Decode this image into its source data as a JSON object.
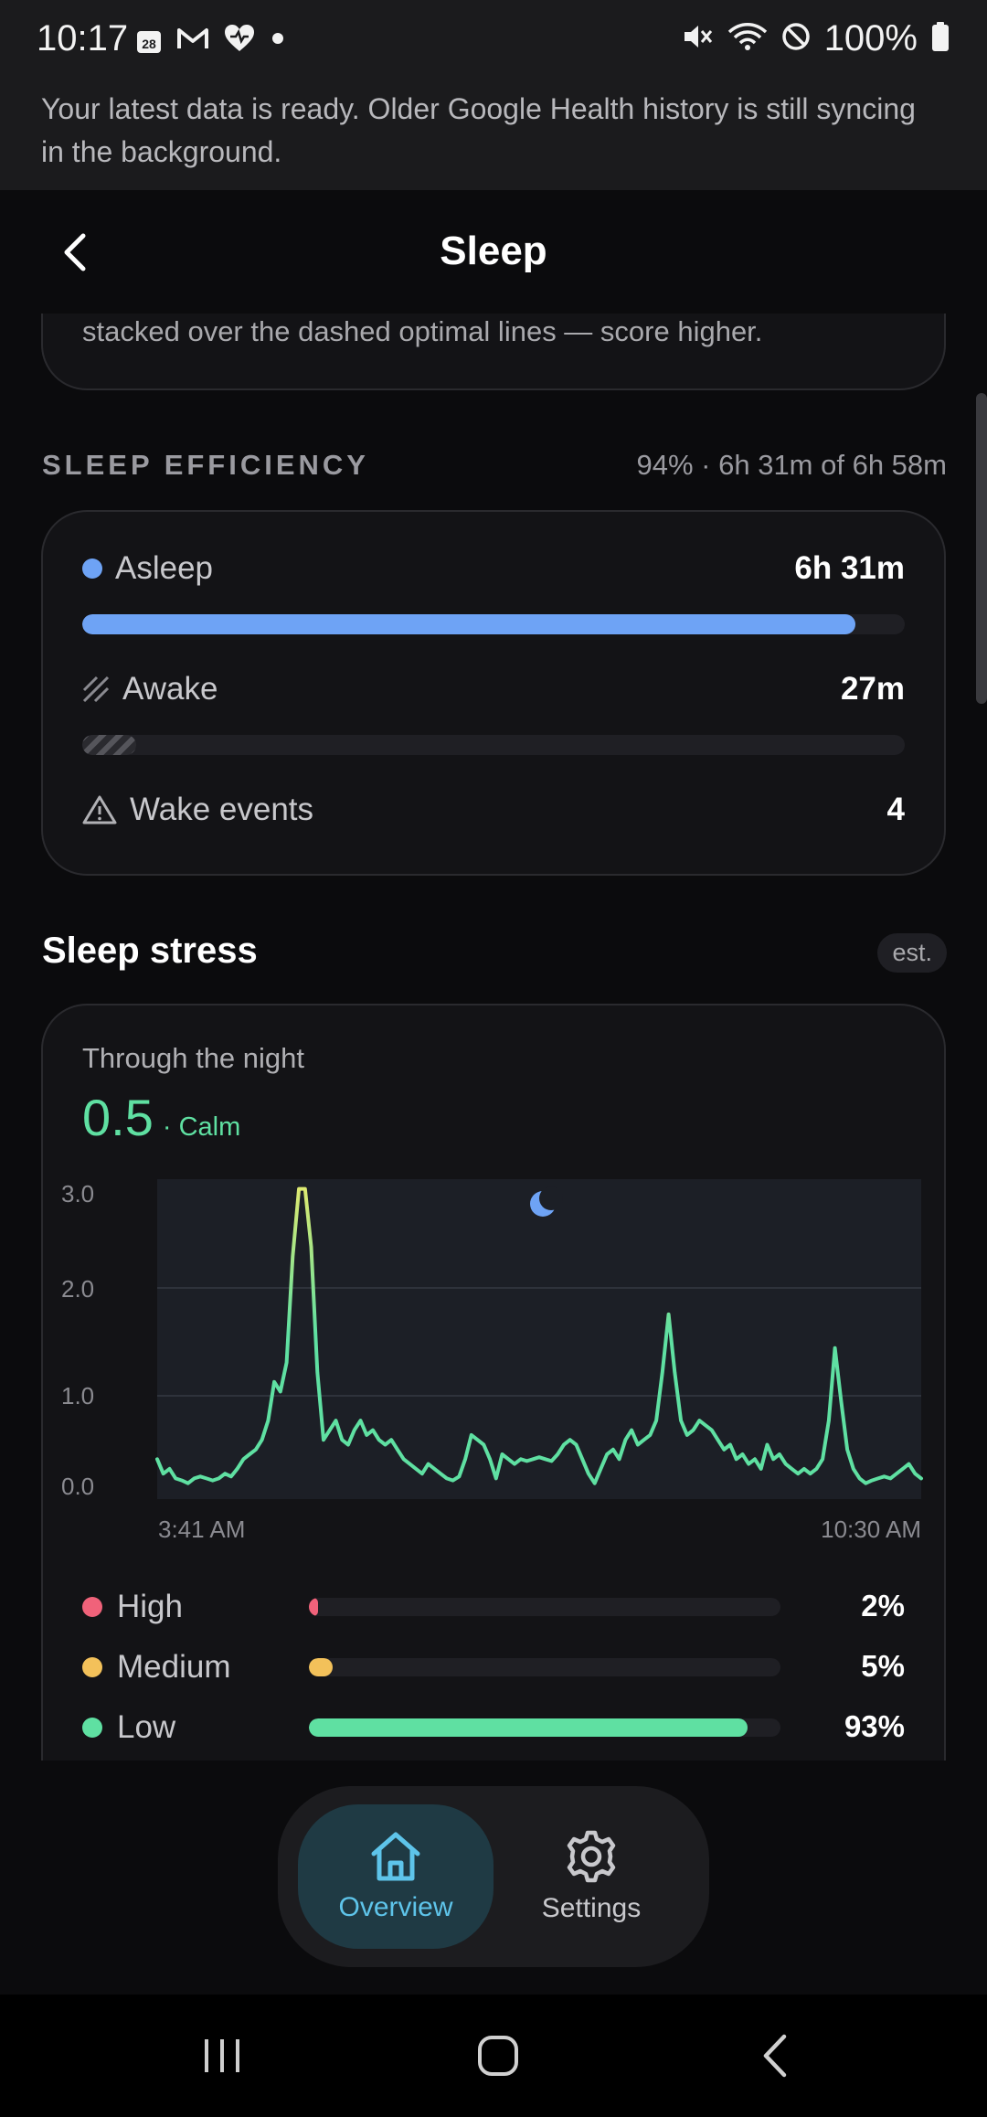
{
  "status_bar": {
    "time": "10:17",
    "calendar_day": "28",
    "battery": "100%",
    "icons_left": [
      "calendar-icon",
      "gmail-icon",
      "health-heart-icon",
      "notification-dot-icon"
    ],
    "icons_right": [
      "mute-icon",
      "wifi-icon",
      "dnd-icon",
      "battery-icon"
    ]
  },
  "banner": {
    "text": "Your latest data is ready. Older Google Health history is still syncing in the background."
  },
  "app_bar": {
    "title": "Sleep",
    "back_icon": "chevron-left-icon"
  },
  "previous_card": {
    "text": "stacked over the dashed optimal lines — score higher."
  },
  "efficiency": {
    "title": "SLEEP EFFICIENCY",
    "summary": "94% · 6h 31m of 6h 58m",
    "asleep": {
      "label": "Asleep",
      "value": "6h 31m",
      "fraction": 0.94,
      "color": "#6ea3f5"
    },
    "awake": {
      "label": "Awake",
      "value": "27m",
      "fraction": 0.065,
      "icon": "hatch-icon"
    },
    "wake_events": {
      "label": "Wake events",
      "value": "4",
      "icon": "warning-triangle-icon"
    }
  },
  "stress": {
    "title": "Sleep stress",
    "badge": "est.",
    "subtitle": "Through the night",
    "score": "0.5",
    "score_label": "· Calm",
    "accent": "#5fe0a2",
    "levels": [
      {
        "label": "High",
        "value": "2%",
        "fraction": 0.02,
        "color": "#f0627a"
      },
      {
        "label": "Medium",
        "value": "5%",
        "fraction": 0.05,
        "color": "#f3c15a"
      },
      {
        "label": "Low",
        "value": "93%",
        "fraction": 0.93,
        "color": "#5fe0a2"
      }
    ]
  },
  "chart_data": {
    "type": "line",
    "title": "",
    "xlabel": "",
    "ylabel": "",
    "ylim": [
      0,
      3.2
    ],
    "y_ticks": [
      "3.0",
      "2.0",
      "1.0",
      "0.0"
    ],
    "x_tick_labels": [
      "3:41 AM",
      "10:30 AM"
    ],
    "grid": true,
    "marker_icon": "moon-icon",
    "line_colors": {
      "low": "#5fe0a2",
      "high": "#e5ea6e"
    },
    "series": [
      {
        "values": [
          0.3,
          0.15,
          0.2,
          0.1,
          0.08,
          0.05,
          0.1,
          0.12,
          0.1,
          0.08,
          0.1,
          0.15,
          0.12,
          0.2,
          0.3,
          0.35,
          0.4,
          0.5,
          0.7,
          1.1,
          1.0,
          1.3,
          2.4,
          3.1,
          3.1,
          2.5,
          1.2,
          0.5,
          0.6,
          0.7,
          0.5,
          0.45,
          0.6,
          0.7,
          0.55,
          0.6,
          0.5,
          0.45,
          0.5,
          0.4,
          0.3,
          0.25,
          0.2,
          0.15,
          0.25,
          0.2,
          0.15,
          0.1,
          0.08,
          0.12,
          0.3,
          0.55,
          0.5,
          0.45,
          0.3,
          0.1,
          0.35,
          0.3,
          0.25,
          0.3,
          0.28,
          0.3,
          0.32,
          0.3,
          0.28,
          0.35,
          0.45,
          0.5,
          0.45,
          0.3,
          0.15,
          0.05,
          0.2,
          0.35,
          0.4,
          0.3,
          0.5,
          0.6,
          0.45,
          0.5,
          0.55,
          0.7,
          1.2,
          1.8,
          1.2,
          0.7,
          0.55,
          0.6,
          0.7,
          0.65,
          0.6,
          0.5,
          0.4,
          0.45,
          0.3,
          0.35,
          0.25,
          0.3,
          0.2,
          0.45,
          0.3,
          0.35,
          0.25,
          0.2,
          0.15,
          0.2,
          0.15,
          0.2,
          0.3,
          0.7,
          1.45,
          0.9,
          0.4,
          0.2,
          0.1,
          0.05,
          0.08,
          0.1,
          0.12,
          0.1,
          0.15,
          0.2,
          0.25,
          0.15,
          0.1
        ]
      }
    ]
  },
  "bottom_nav": {
    "items": [
      {
        "label": "Overview",
        "icon": "home-icon",
        "active": true
      },
      {
        "label": "Settings",
        "icon": "gear-icon",
        "active": false
      }
    ]
  },
  "system_nav": {
    "recents_icon": "recents-icon",
    "home_icon": "home-button-icon",
    "back_icon": "back-icon"
  }
}
